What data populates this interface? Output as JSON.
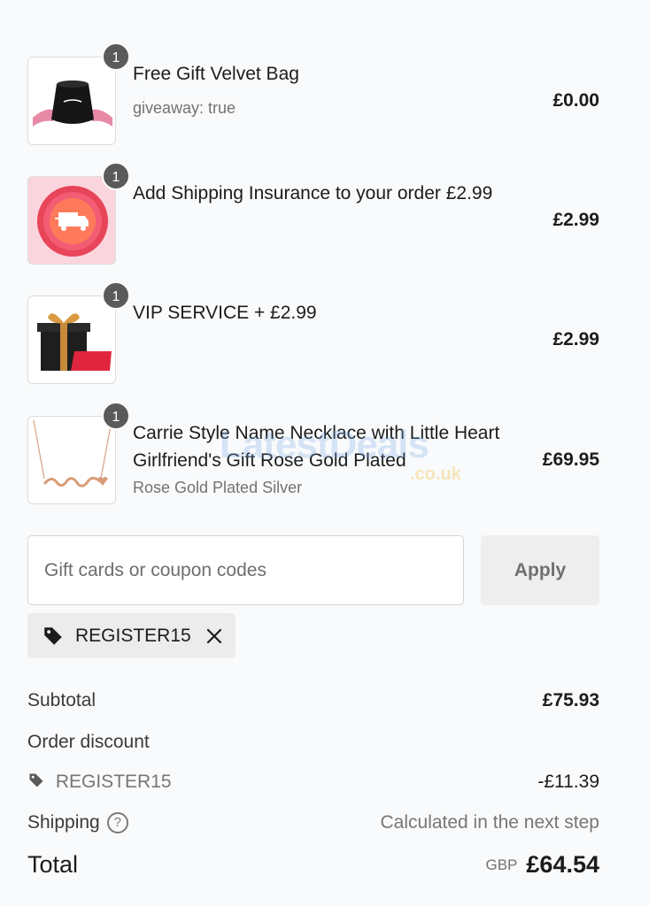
{
  "cart": {
    "items": [
      {
        "title": "Free Gift Velvet Bag",
        "subtitle": "giveaway: true",
        "price": "£0.00",
        "quantity": "1",
        "image_icon": "velvet-bag-icon"
      },
      {
        "title": "Add Shipping Insurance to your order £2.99",
        "subtitle": "",
        "price": "£2.99",
        "quantity": "1",
        "image_icon": "shipping-insurance-badge-icon"
      },
      {
        "title": "VIP SERVICE + £2.99",
        "subtitle": "",
        "price": "£2.99",
        "quantity": "1",
        "image_icon": "vip-gift-box-icon"
      },
      {
        "title": "Carrie Style Name Necklace with Little Heart Girlfriend's Gift Rose Gold Plated",
        "subtitle": "Rose Gold Plated Silver",
        "price": "£69.95",
        "quantity": "1",
        "image_icon": "name-necklace-icon"
      }
    ]
  },
  "coupon": {
    "placeholder": "Gift cards or coupon codes",
    "apply_label": "Apply",
    "applied_code": "REGISTER15"
  },
  "summary": {
    "subtotal_label": "Subtotal",
    "subtotal_value": "£75.93",
    "discount_label": "Order discount",
    "discount_code": "REGISTER15",
    "discount_value": "-£11.39",
    "shipping_label": "Shipping",
    "shipping_value": "Calculated in the next step",
    "total_label": "Total",
    "total_currency": "GBP",
    "total_value": "£64.54"
  },
  "watermark": {
    "main": "LatestDeals",
    "sub": ".co.uk"
  },
  "colors": {
    "background": "#f9fafb",
    "badge": "#5a5a5a",
    "apply_bg": "#eeeeee",
    "chip_bg": "#ececec"
  }
}
